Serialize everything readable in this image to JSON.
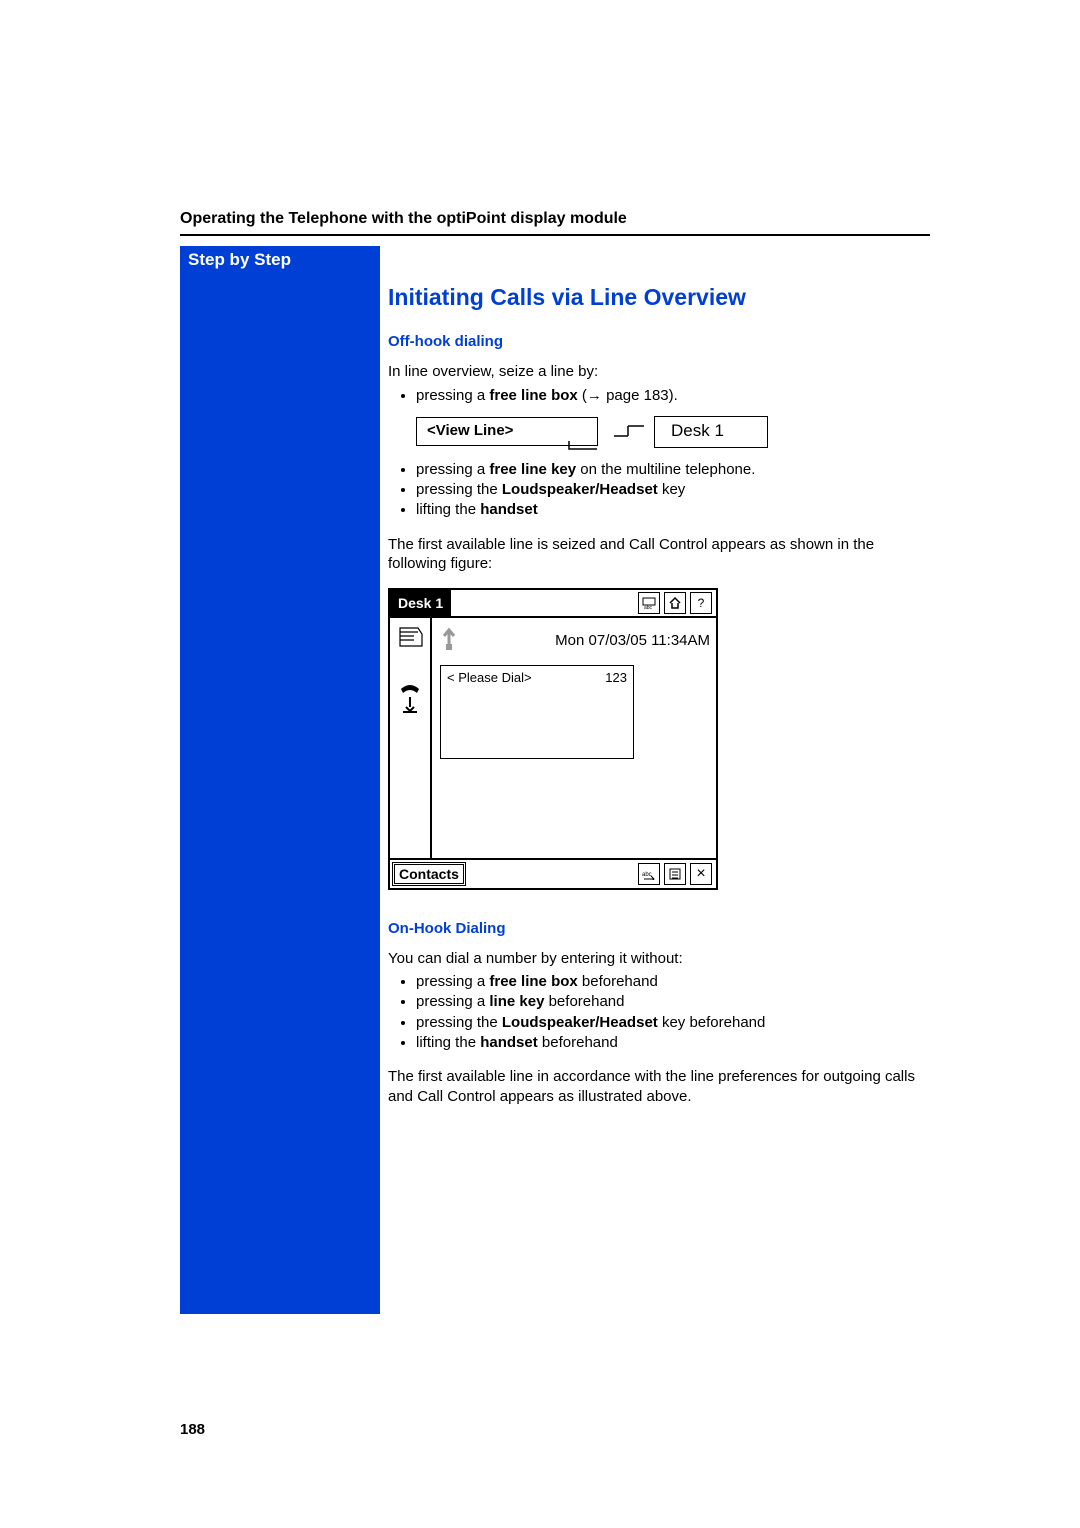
{
  "header": {
    "running_head": "Operating the Telephone with the optiPoint display module"
  },
  "sidebar": {
    "label": "Step by Step"
  },
  "main": {
    "title": "Initiating Calls via Line Overview",
    "off_hook": {
      "heading": "Off-hook dialing",
      "intro": "In line overview, seize a line by:",
      "bullet1_prefix": "pressing a ",
      "bullet1_bold": "free line box",
      "bullet1_suffix": " (",
      "bullet1_arrow": "→",
      "bullet1_page": " page 183).",
      "viewline_label": "<View Line>",
      "desk_label": "Desk 1",
      "bullet2_prefix": "pressing a ",
      "bullet2_bold": "free line key",
      "bullet2_suffix": " on the multiline telephone.",
      "bullet3_prefix": "pressing the ",
      "bullet3_bold": "Loudspeaker/Headset",
      "bullet3_suffix": " key",
      "bullet4_prefix": "lifting the ",
      "bullet4_bold": "handset",
      "after_list": "The first available line is seized and Call Control appears as shown in the following figure:"
    },
    "figure": {
      "tab": "Desk 1",
      "timestamp": "Mon 07/03/05 11:34AM",
      "dial_prompt": "< Please Dial>",
      "dial_num": "123",
      "contacts": "Contacts",
      "help_icon": "?",
      "close_icon": "×"
    },
    "on_hook": {
      "heading": "On-Hook Dialing",
      "intro": "You can dial a number by entering it without:",
      "b1_prefix": "pressing a ",
      "b1_bold": "free line box",
      "b1_suffix": " beforehand",
      "b2_prefix": "pressing a ",
      "b2_bold": "line key",
      "b2_suffix": " beforehand",
      "b3_prefix": "pressing the ",
      "b3_bold": "Loudspeaker/Headset",
      "b3_suffix": " key beforehand",
      "b4_prefix": "lifting the ",
      "b4_bold": "handset ",
      "b4_suffix": " beforehand",
      "after_list": "The first available line in accordance with the line preferences for outgoing calls and Call Control appears as illustrated above."
    }
  },
  "page_number": "188"
}
